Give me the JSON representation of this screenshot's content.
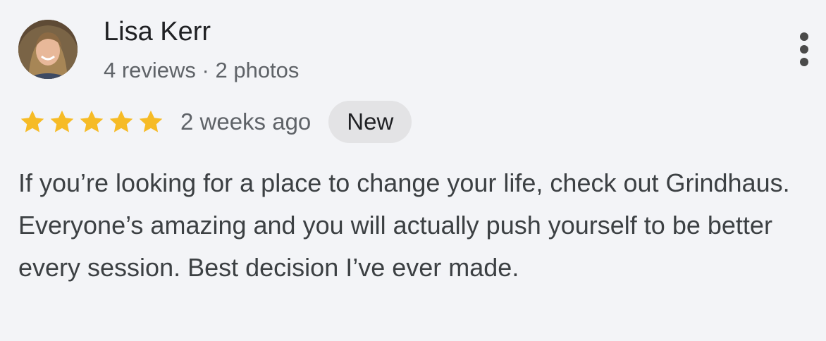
{
  "review": {
    "reviewer": {
      "name": "Lisa Kerr",
      "meta": "4 reviews · 2 photos",
      "avatar_icon": "person-photo"
    },
    "rating": {
      "stars": 5,
      "max_stars": 5,
      "star_color": "#f6bb26"
    },
    "time": "2 weeks ago",
    "badge": "New",
    "text": "If you’re looking for a place to change your life, check out Grindhaus. Everyone’s amazing and you will actually push yourself to be better every session. Best decision I’ve ever made.",
    "more_icon": "more-vert-icon"
  },
  "colors": {
    "background": "#f3f4f7",
    "primary_text": "#202124",
    "secondary_text": "#5f6368",
    "badge_background": "#e3e3e5"
  }
}
